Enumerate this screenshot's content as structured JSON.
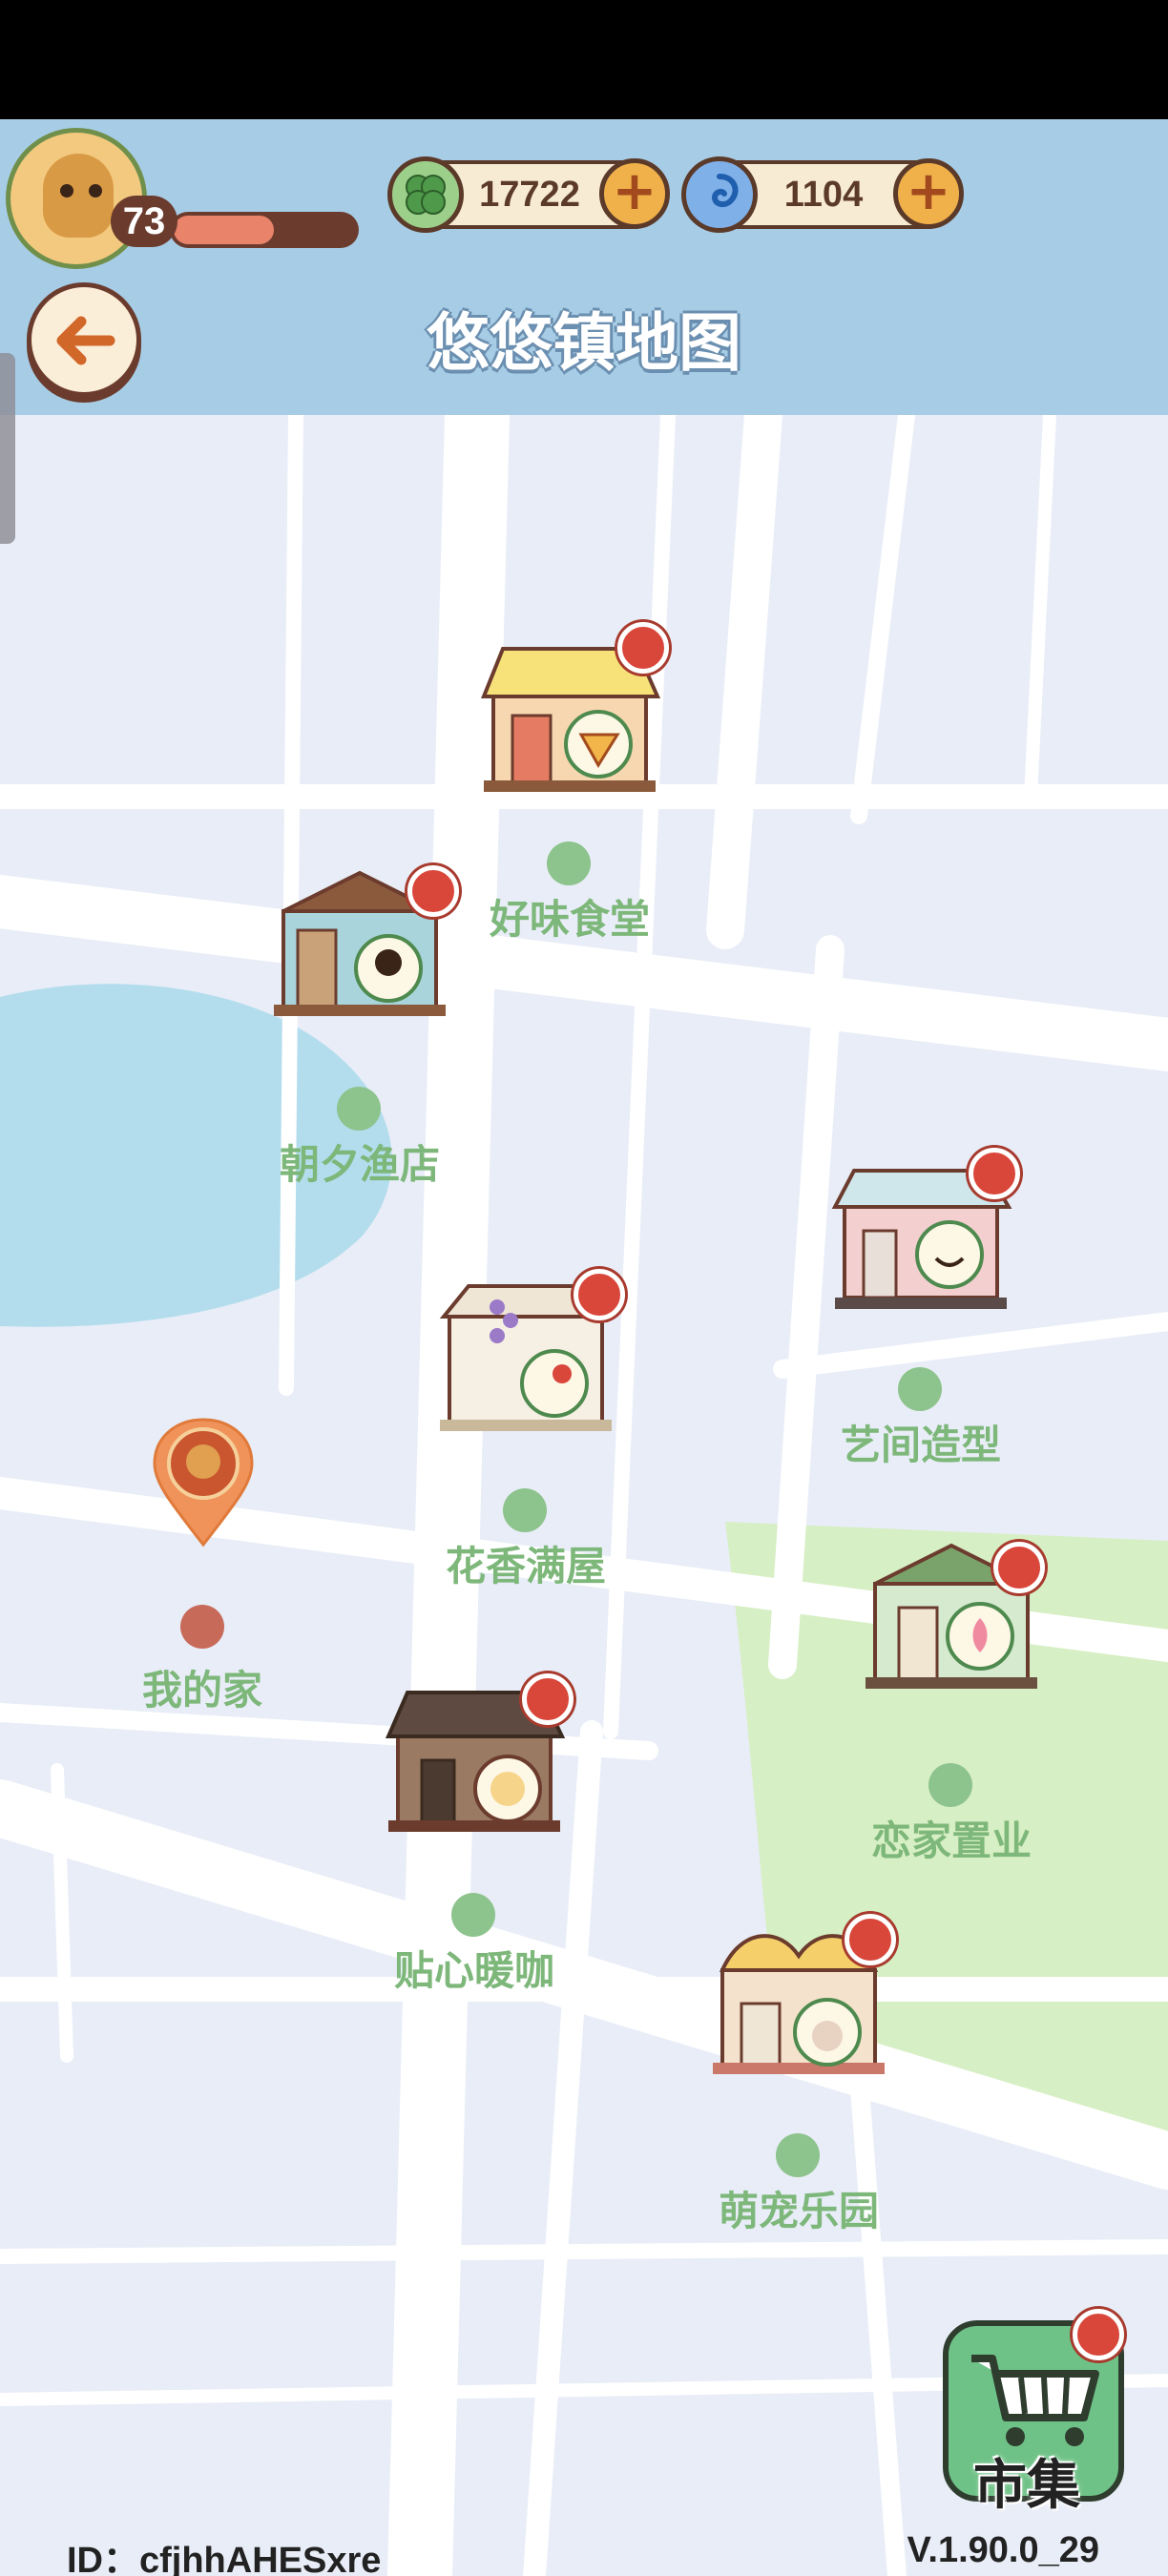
{
  "header": {
    "title": "悠悠镇地图",
    "level": "73",
    "xp_fraction": 0.55,
    "clover": {
      "value": "17722",
      "icon": "clover-icon"
    },
    "orb": {
      "value": "1104",
      "icon": "swirl-orb-icon"
    },
    "back_icon": "arrow-left-icon",
    "plus_label": "+"
  },
  "shops": [
    {
      "name": "好味食堂",
      "icon": "pizza-icon"
    },
    {
      "name": "朝夕渔店",
      "icon": "fisher-icon"
    },
    {
      "name": "艺间造型",
      "icon": "stylist-icon"
    },
    {
      "name": "花香满屋",
      "icon": "flower-icon"
    },
    {
      "name": "恋家置业",
      "icon": "lotus-icon"
    },
    {
      "name": "贴心暖咖",
      "icon": "coffee-icon"
    },
    {
      "name": "萌宠乐园",
      "icon": "pet-icon"
    }
  ],
  "home": {
    "name": "我的家"
  },
  "market": {
    "label": "市集",
    "icon": "shopping-cart-icon"
  },
  "footer": {
    "id": "ID：cfjhhAHESxre",
    "version": "V.1.90.0_29"
  },
  "colors": {
    "header_bg": "#a7cde6",
    "map_bg": "#e8edf7",
    "label_green": "#7db77a",
    "notification_red": "#d9463a",
    "park_green": "#d7efc4",
    "lake_blue": "#b3dded"
  }
}
